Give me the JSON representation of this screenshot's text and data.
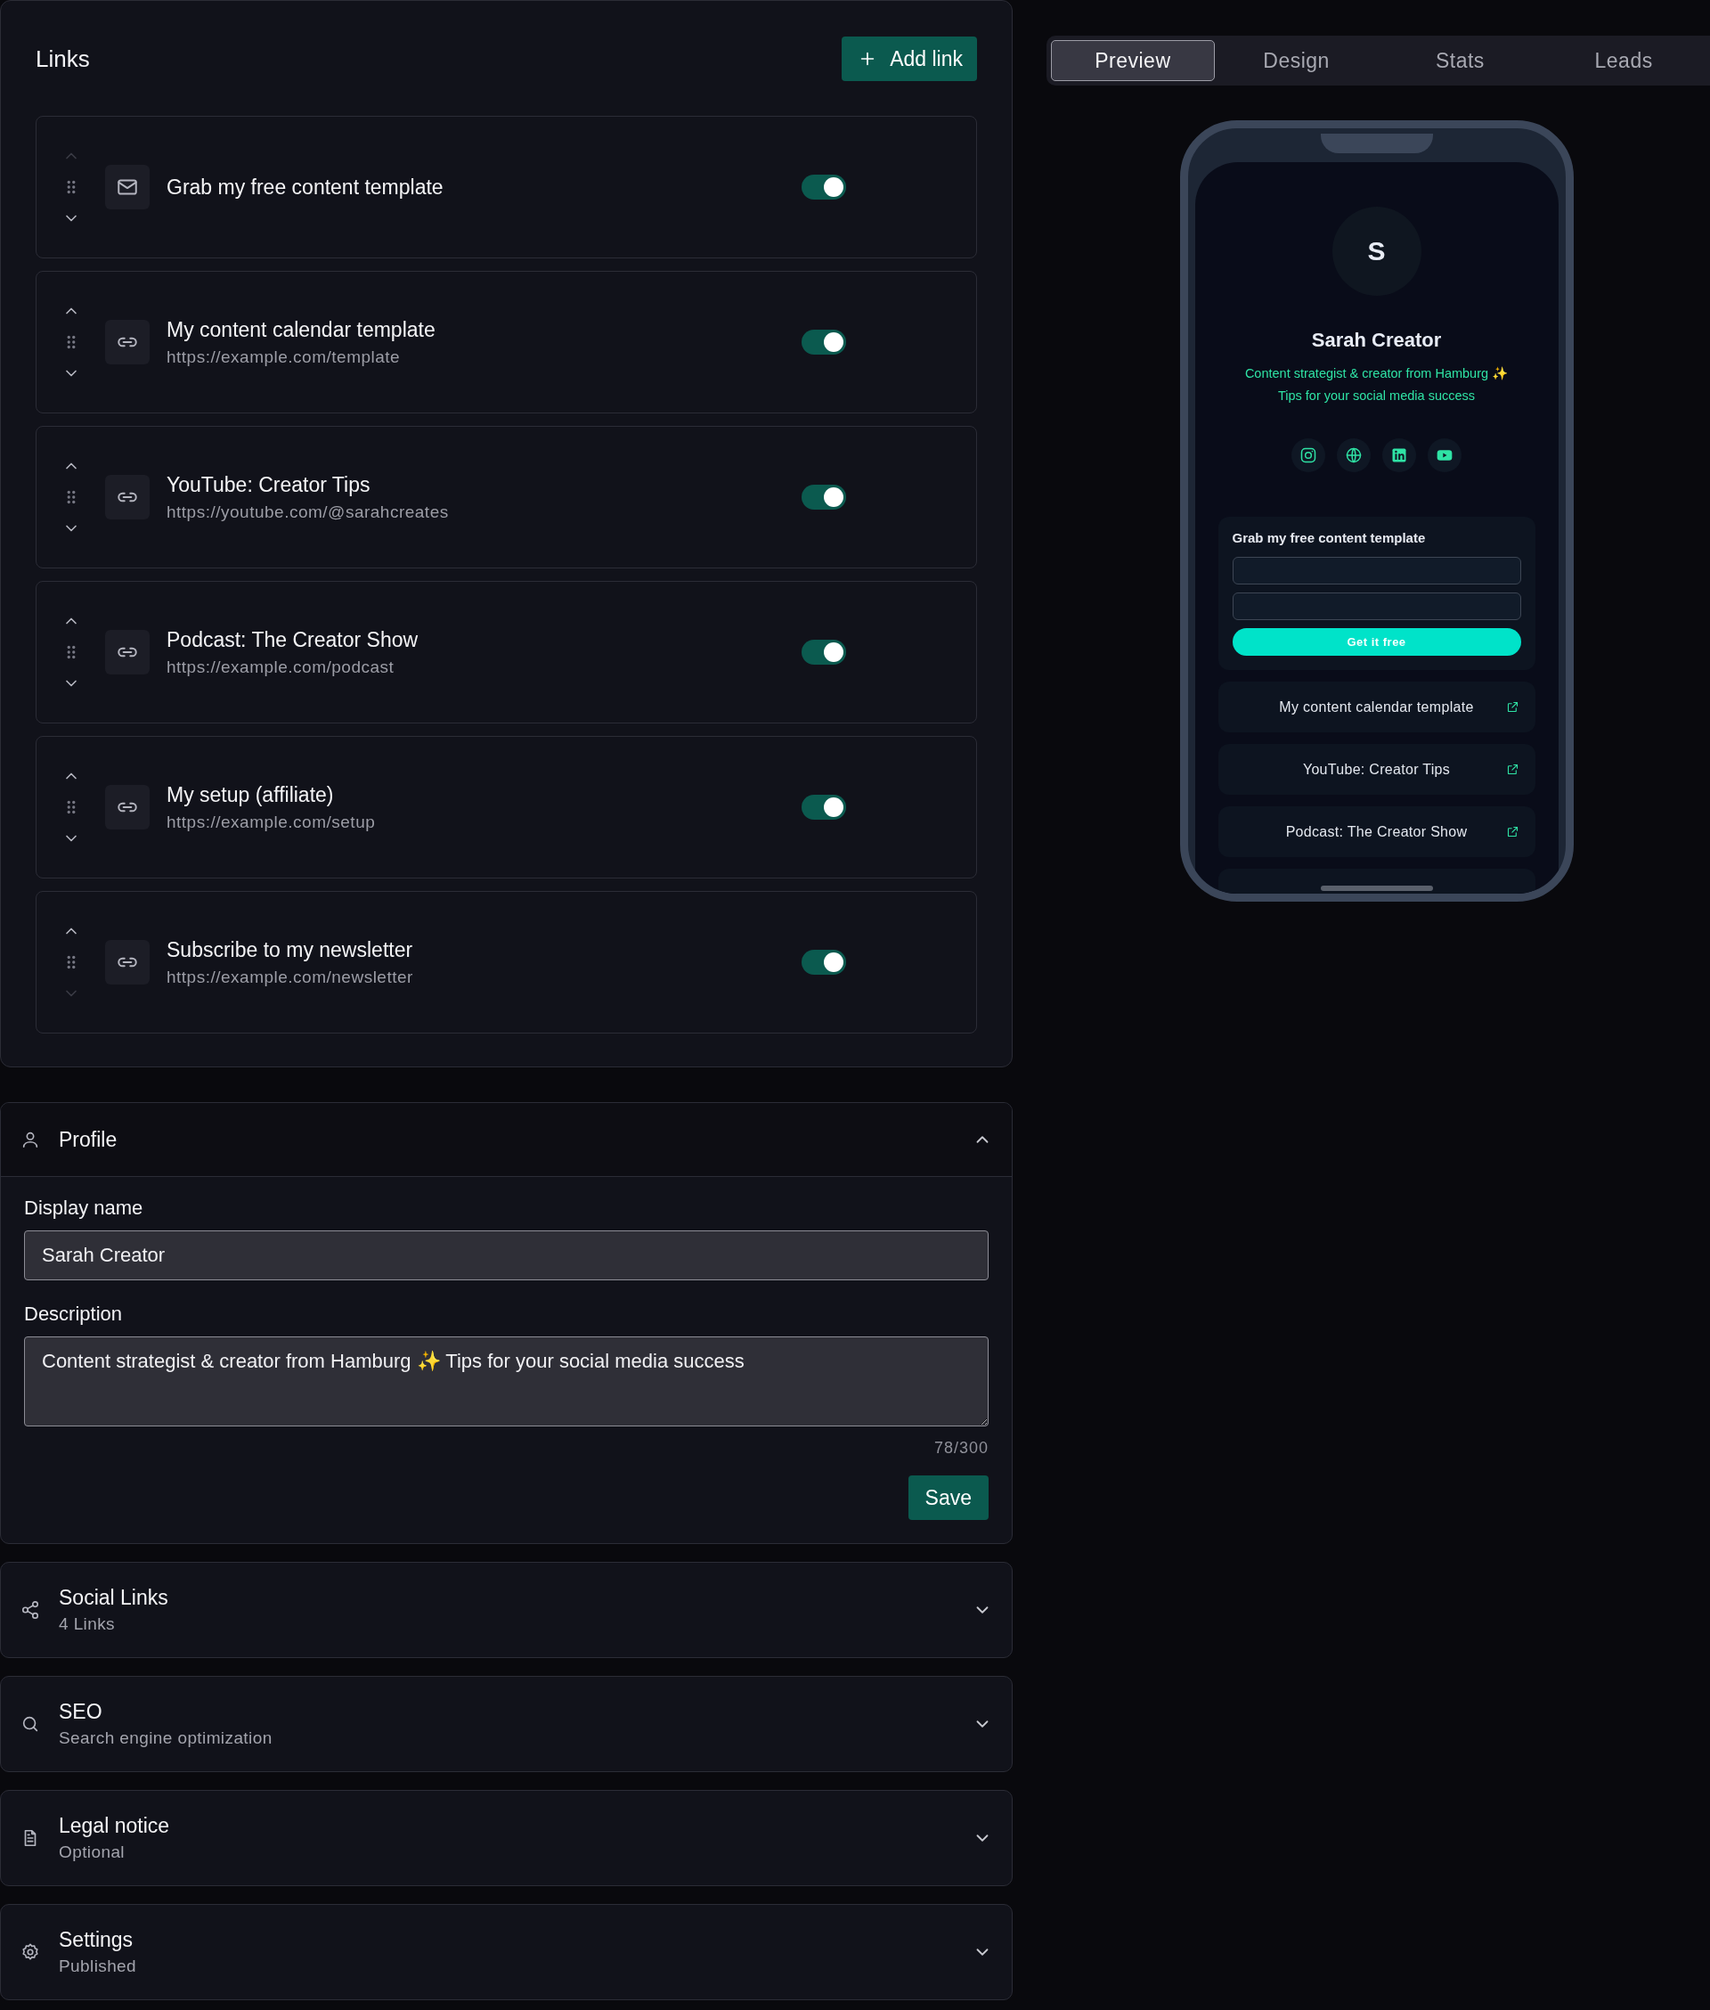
{
  "links_panel": {
    "title": "Links",
    "add_button": "Add link",
    "items": [
      {
        "kind": "form",
        "title": "Grab my free content template",
        "enabled": true,
        "can_move_up": false,
        "can_move_down": true
      },
      {
        "kind": "link",
        "title": "My content calendar template",
        "url": "https://example.com/template",
        "enabled": true,
        "can_move_up": true,
        "can_move_down": true
      },
      {
        "kind": "link",
        "title": "YouTube: Creator Tips",
        "url": "https://youtube.com/@sarahcreates",
        "enabled": true,
        "can_move_up": true,
        "can_move_down": true
      },
      {
        "kind": "link",
        "title": "Podcast: The Creator Show",
        "url": "https://example.com/podcast",
        "enabled": true,
        "can_move_up": true,
        "can_move_down": true
      },
      {
        "kind": "link",
        "title": "My setup (affiliate)",
        "url": "https://example.com/setup",
        "enabled": true,
        "can_move_up": true,
        "can_move_down": true
      },
      {
        "kind": "link",
        "title": "Subscribe to my newsletter",
        "url": "https://example.com/newsletter",
        "enabled": true,
        "can_move_up": true,
        "can_move_down": false
      }
    ]
  },
  "profile": {
    "title": "Profile",
    "expanded": true,
    "display_name_label": "Display name",
    "display_name_value": "Sarah Creator",
    "description_label": "Description",
    "description_value": "Content strategist & creator from Hamburg ✨ Tips for your social media success",
    "char_count": "78/300",
    "save_button": "Save"
  },
  "sections": [
    {
      "kind": "share",
      "title": "Social Links",
      "subtitle": "4 Links",
      "expanded": false
    },
    {
      "kind": "search",
      "title": "SEO",
      "subtitle": "Search engine optimization",
      "expanded": false
    },
    {
      "kind": "document",
      "title": "Legal notice",
      "subtitle": "Optional",
      "expanded": false
    },
    {
      "kind": "settings",
      "title": "Settings",
      "subtitle": "Published",
      "expanded": false
    }
  ],
  "tabs": [
    {
      "label": "Preview",
      "selected": true
    },
    {
      "label": "Design",
      "selected": false
    },
    {
      "label": "Stats",
      "selected": false
    },
    {
      "label": "Leads",
      "selected": false
    }
  ],
  "preview": {
    "avatar_initial": "S",
    "name": "Sarah Creator",
    "bio_lines": [
      "Content strategist & creator from Hamburg ✨",
      "Tips for your social media success"
    ],
    "socials": [
      {
        "kind": "instagram"
      },
      {
        "kind": "globe"
      },
      {
        "kind": "linkedin"
      },
      {
        "kind": "youtube"
      }
    ],
    "form": {
      "title": "Grab my free content template",
      "button": "Get it free"
    },
    "links": [
      {
        "title": "My content calendar template"
      },
      {
        "title": "YouTube: Creator Tips"
      },
      {
        "title": "Podcast: The Creator Show"
      }
    ]
  }
}
